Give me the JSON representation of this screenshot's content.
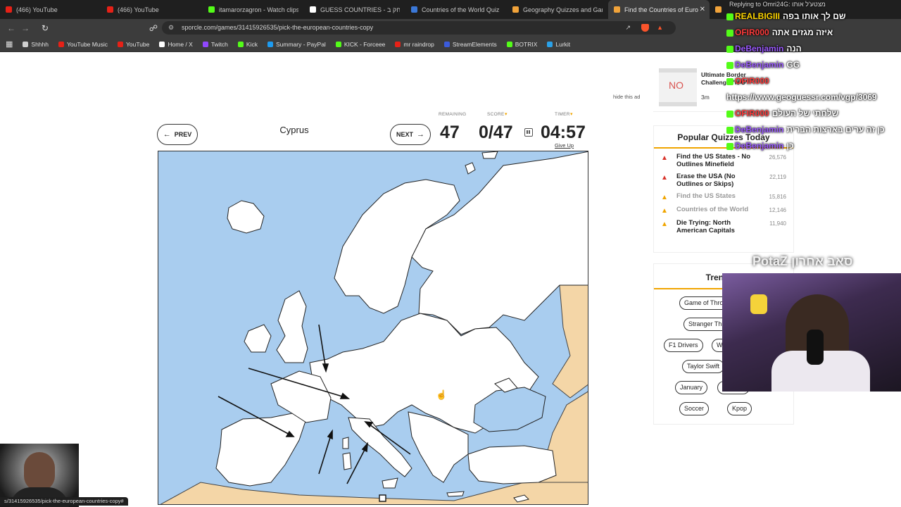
{
  "tabs": [
    {
      "label": "(466) YouTube",
      "color": "#e62117"
    },
    {
      "label": "(466) YouTube",
      "color": "#e62117"
    },
    {
      "label": "itamarorzagron - Watch clips o",
      "color": "#53fc18"
    },
    {
      "label": "GUESS COUNTRIES - המשחק ב",
      "color": "#ffffff"
    },
    {
      "label": "Countries of the World Quiz",
      "color": "#3b78d8"
    },
    {
      "label": "Geography Quizzes and Games",
      "color": "#f1a33a"
    },
    {
      "label": "Find the Countries of Euro",
      "color": "#f1a33a",
      "active": true
    },
    {
      "label": "U",
      "color": "#f1a33a"
    }
  ],
  "address": {
    "url": "sporcle.com/games/31415926535/pick-the-european-countries-copy"
  },
  "bookmarks": [
    {
      "label": "Shhhh",
      "color": "#cfcfcf"
    },
    {
      "label": "YouTube Music",
      "color": "#e62117"
    },
    {
      "label": "YouTube",
      "color": "#e62117"
    },
    {
      "label": "Home / X",
      "color": "#ffffff"
    },
    {
      "label": "Twitch",
      "color": "#9147ff"
    },
    {
      "label": "Kick",
      "color": "#53fc18"
    },
    {
      "label": "Summary - PayPal",
      "color": "#1d9bf0"
    },
    {
      "label": "KICK - Forceee",
      "color": "#53fc18"
    },
    {
      "label": "mr raindrop",
      "color": "#e62117"
    },
    {
      "label": "StreamElements",
      "color": "#3b5bdb"
    },
    {
      "label": "BOTRIX",
      "color": "#53fc18"
    },
    {
      "label": "Lurkit",
      "color": "#2aa1e8"
    }
  ],
  "game": {
    "prev": "PREV",
    "next": "NEXT",
    "current_country": "Cyprus",
    "remaining_label": "REMAINING",
    "remaining": "47",
    "score_label": "SCORE",
    "score": "0/47",
    "timer_label": "TIMER",
    "timer": "04:57",
    "give_up": "Give Up"
  },
  "ad": {
    "title": "Ultimate Border Challenge: 'N-O'",
    "time": "3m",
    "thumb_text": "NO",
    "hide": "hide this ad"
  },
  "popular": {
    "title": "Popular Quizzes Today",
    "items": [
      {
        "name": "Find the US States - No Outlines Minefield",
        "count": "26,576",
        "hot": true
      },
      {
        "name": "Erase the USA (No Outlines or Skips)",
        "count": "22,119",
        "hot": true
      },
      {
        "name": "Find the US States",
        "count": "15,816",
        "hot": false
      },
      {
        "name": "Countries of the World",
        "count": "12,146",
        "hot": false
      },
      {
        "name": "Die Trying: North American Capitals",
        "count": "11,940",
        "hot": false
      }
    ]
  },
  "trending": {
    "title": "Trending",
    "tags": [
      "Game of Thrones",
      "Stranger Things",
      "F1 Drivers",
      "W",
      "Taylor Swift",
      "January",
      "Country",
      "Soccer",
      "Kpop"
    ]
  },
  "chat": {
    "reply": "Replying to Omri24G: מצטע'ל אותו",
    "lines": [
      {
        "user": "REALBIGIII",
        "text": "שם לך אותו בפה",
        "color": "#ffd700"
      },
      {
        "user": "OFIR000",
        "text": "איזה מגזים אתה",
        "color": "#ff3b3b"
      },
      {
        "user": "DeBenjamin",
        "text": "הנה",
        "color": "#9b59ff"
      },
      {
        "user": "DeBenjamin",
        "text": "GG",
        "color": "#9b59ff"
      },
      {
        "user": "OFIR000",
        "text": "",
        "color": "#ff3b3b"
      },
      {
        "user": "",
        "text": "https://www.geoguessr.com/vgp/3069",
        "color": "#ffffff"
      },
      {
        "user": "OFIR000",
        "text": "שלחתי של העולם",
        "color": "#ff3b3b"
      },
      {
        "user": "DeBenjamin",
        "text": "כן זה ערים בארצות הברית",
        "color": "#9b59ff"
      },
      {
        "user": "DeBenjamin",
        "text": "כן",
        "color": "#9b59ff"
      }
    ],
    "streamer_text": "PotaZ סאב אחרון"
  },
  "status_url": "s/31415926535/pick-the-european-countries-copy#"
}
